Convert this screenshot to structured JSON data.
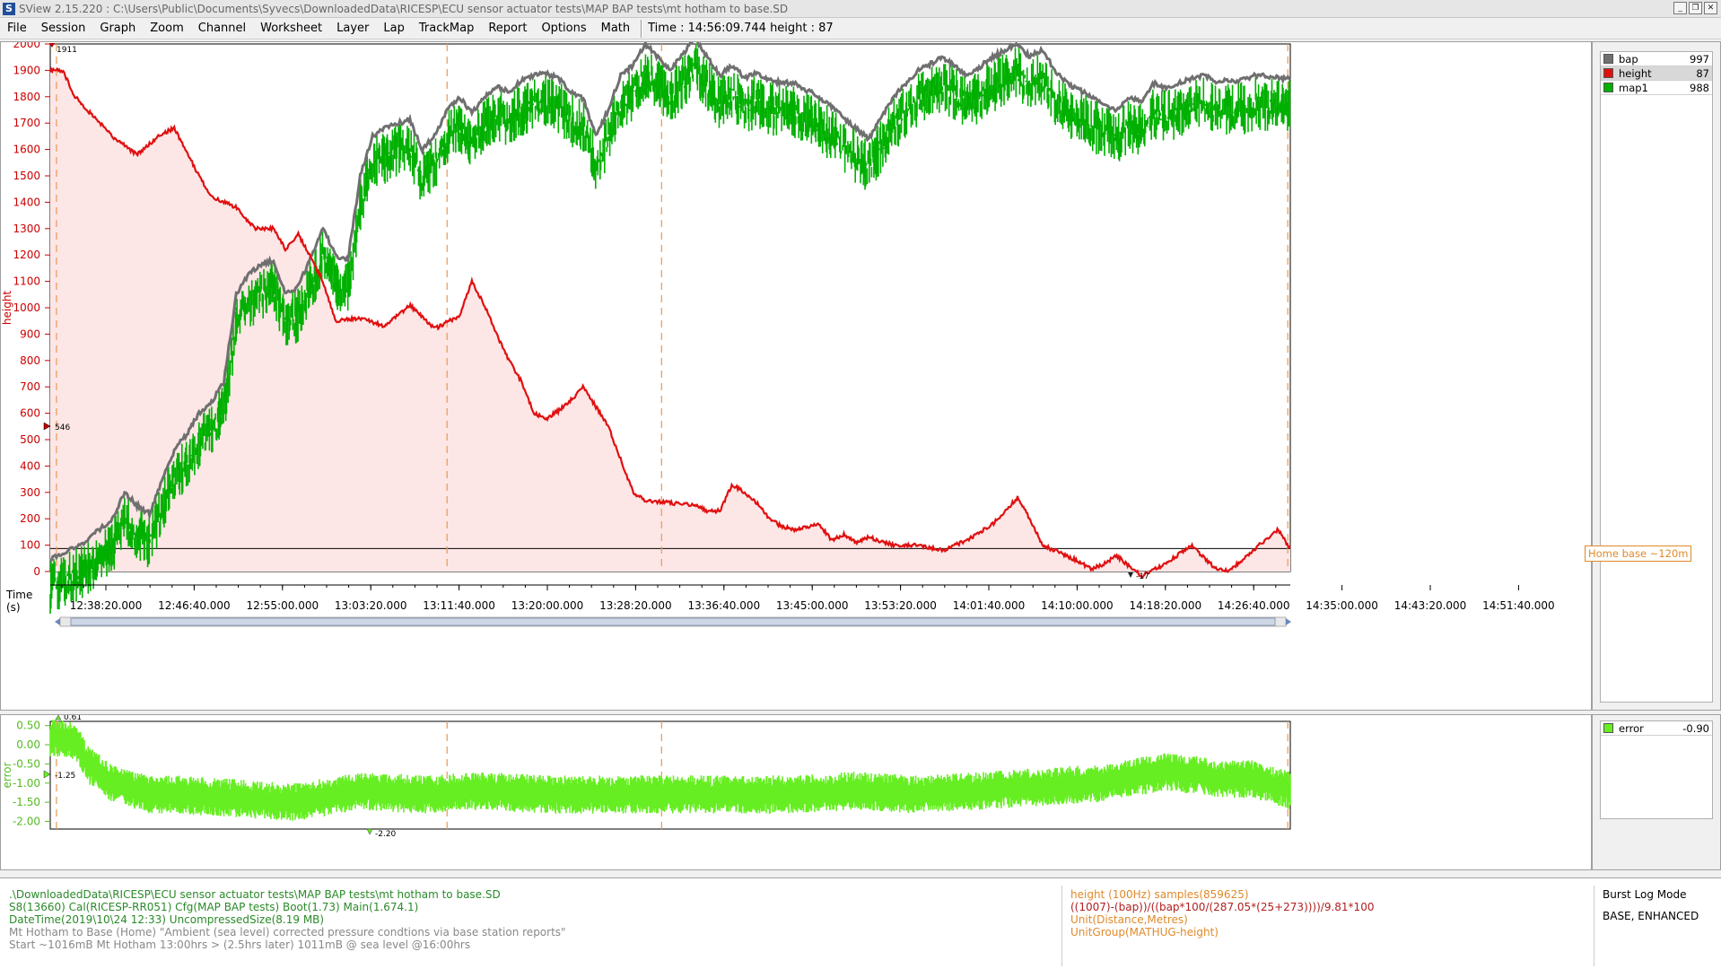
{
  "titlebar": {
    "title": "SView 2.15.220  :  C:\\Users\\Public\\Documents\\Syvecs\\DownloadedData\\RICESP\\ECU sensor actuator tests\\MAP BAP tests\\mt hotham to base.SD"
  },
  "menu": [
    "File",
    "Session",
    "Graph",
    "Zoom",
    "Channel",
    "Worksheet",
    "Layer",
    "Lap",
    "TrackMap",
    "Report",
    "Options",
    "Math"
  ],
  "status": "Time : 14:56:09.744  height : 87",
  "main_legend": [
    {
      "name": "bap",
      "value": "997",
      "color": "#6f6f6f"
    },
    {
      "name": "height",
      "value": "87",
      "color": "#e01010"
    },
    {
      "name": "map1",
      "value": "988",
      "color": "#00b000"
    }
  ],
  "error_legend": [
    {
      "name": "error",
      "value": "-0.90",
      "color": "#66ee22"
    }
  ],
  "annotation": "Home base ~120m",
  "bottom": {
    "left": [
      ".\\DownloadedData\\RICESP\\ECU sensor actuator tests\\MAP BAP tests\\mt hotham to base.SD",
      "S8(13660) Cal(RICESP-RR051) Cfg(MAP BAP tests) Boot(1.73) Main(1.674.1)",
      "DateTime(2019\\10\\24 12:33) UncompressedSize(8.19 MB)",
      "Mt Hotham to Base (Home) \"Ambient (sea level) corrected pressure condtions via base station reports\"",
      "Start ~1016mB Mt Hotham 13:00hrs > (2.5hrs later) 1011mB @ sea level @16:00hrs"
    ],
    "middle": [
      "height (100Hz) samples(859625)",
      "((1007)-(bap))/((bap*100/(287.05*(25+273))))/9.81*100",
      "Unit(Distance,Metres)",
      "UnitGroup(MATHUG-height)"
    ],
    "right": [
      "Burst Log Mode",
      "BASE, ENHANCED"
    ]
  },
  "chart_data": [
    {
      "type": "line",
      "ylabel": "height",
      "ylim": [
        0,
        2000
      ],
      "y_ticks": [
        "0",
        "100",
        "200",
        "300",
        "400",
        "500",
        "600",
        "700",
        "800",
        "900",
        "1000",
        "1100",
        "1200",
        "1300",
        "1400",
        "1500",
        "1600",
        "1700",
        "1800",
        "1900",
        "2000"
      ],
      "x_ticks": [
        "12:38:20.000",
        "12:46:40.000",
        "12:55:00.000",
        "13:03:20.000",
        "13:11:40.000",
        "13:20:00.000",
        "13:28:20.000",
        "13:36:40.000",
        "13:45:00.000",
        "13:53:20.000",
        "14:01:40.000",
        "14:10:00.000",
        "14:18:20.000",
        "14:26:40.000",
        "14:35:00.000",
        "14:43:20.000",
        "14:51:40.000"
      ],
      "xlabel": "Time",
      "xunit": "(s)",
      "markers": {
        "max": "1911",
        "cursor": "546",
        "min": "-17"
      },
      "reference_line": 87,
      "series": [
        {
          "name": "height",
          "color": "#e01010",
          "x": [
            0,
            1,
            2,
            3,
            5,
            7,
            9,
            10,
            12,
            13,
            15,
            16.5,
            18,
            19,
            20,
            22,
            23,
            25,
            27,
            29,
            31,
            33,
            34,
            35,
            36,
            37,
            38,
            39,
            40,
            41,
            42,
            43,
            45,
            47,
            48,
            50,
            52,
            53,
            54,
            55,
            56,
            57,
            58,
            59,
            60,
            62,
            63,
            64,
            65,
            66,
            68,
            70,
            72,
            74,
            76,
            78,
            79,
            80,
            82,
            84,
            85,
            86,
            88,
            90,
            92,
            94,
            95,
            97,
            99,
            100
          ],
          "y": [
            1900,
            1900,
            1800,
            1750,
            1650,
            1580,
            1660,
            1680,
            1500,
            1420,
            1380,
            1300,
            1300,
            1220,
            1280,
            1100,
            950,
            960,
            930,
            1010,
            920,
            970,
            1100,
            1010,
            900,
            800,
            720,
            600,
            580,
            610,
            650,
            700,
            550,
            300,
            270,
            260,
            250,
            230,
            230,
            330,
            300,
            260,
            200,
            170,
            160,
            180,
            120,
            140,
            110,
            130,
            100,
            100,
            80,
            120,
            180,
            280,
            200,
            100,
            60,
            10,
            30,
            60,
            -17,
            30,
            100,
            10,
            0,
            80,
            160,
            87
          ]
        },
        {
          "name": "bap",
          "color": "#6f6f6f",
          "x": [
            0,
            1,
            2,
            3,
            4,
            5,
            6,
            7,
            8,
            9,
            10,
            11,
            12,
            13,
            14,
            15,
            16,
            17,
            18,
            19,
            20,
            22,
            23,
            24,
            25,
            26,
            27,
            28,
            29,
            30,
            31,
            32,
            33,
            34,
            35,
            36,
            37,
            38,
            39,
            40,
            41,
            42,
            43,
            44,
            45,
            46,
            47,
            48,
            50,
            52,
            53,
            54,
            55,
            56,
            57,
            58,
            60,
            62,
            64,
            66,
            68,
            70,
            72,
            74,
            76,
            78,
            79,
            80,
            81,
            82,
            84,
            86,
            87,
            88,
            89,
            90,
            91,
            92,
            93,
            94,
            95,
            96,
            97,
            98,
            99,
            100
          ],
          "y": [
            50,
            70,
            90,
            120,
            160,
            200,
            300,
            250,
            220,
            340,
            460,
            520,
            600,
            640,
            720,
            1050,
            1130,
            1160,
            1180,
            1050,
            1080,
            1300,
            1200,
            1180,
            1500,
            1650,
            1680,
            1700,
            1710,
            1600,
            1650,
            1750,
            1800,
            1740,
            1800,
            1840,
            1820,
            1860,
            1880,
            1890,
            1870,
            1820,
            1790,
            1650,
            1750,
            1880,
            1920,
            2000,
            1900,
            2020,
            1950,
            1880,
            1920,
            1870,
            1890,
            1860,
            1850,
            1800,
            1720,
            1640,
            1800,
            1900,
            1950,
            1880,
            1950,
            2000,
            1950,
            1980,
            1900,
            1850,
            1800,
            1750,
            1800,
            1780,
            1850,
            1830,
            1850,
            1870,
            1880,
            1860,
            1860,
            1860,
            1880,
            1880,
            1870,
            1870
          ]
        }
      ]
    },
    {
      "type": "line",
      "ylabel": "error",
      "ylim": [
        -2.2,
        0.61
      ],
      "y_ticks": [
        "0.50",
        "0.00",
        "-0.50",
        "-1.00",
        "-1.50",
        "-2.00"
      ],
      "markers": {
        "max": "0.61",
        "cursor": "-1.25",
        "min": "-2.20"
      },
      "series": [
        {
          "name": "error",
          "color": "#66ee22",
          "x": [
            0,
            2,
            3,
            5,
            8,
            10,
            15,
            20,
            25,
            30,
            35,
            40,
            45,
            50,
            55,
            60,
            65,
            70,
            75,
            80,
            85,
            90,
            95,
            97,
            100
          ],
          "y": [
            0.2,
            0.1,
            -0.5,
            -1.0,
            -1.3,
            -1.3,
            -1.4,
            -1.5,
            -1.2,
            -1.3,
            -1.2,
            -1.3,
            -1.3,
            -1.3,
            -1.3,
            -1.3,
            -1.2,
            -1.3,
            -1.2,
            -1.1,
            -1.0,
            -0.7,
            -0.9,
            -0.9,
            -1.2
          ]
        }
      ]
    }
  ]
}
